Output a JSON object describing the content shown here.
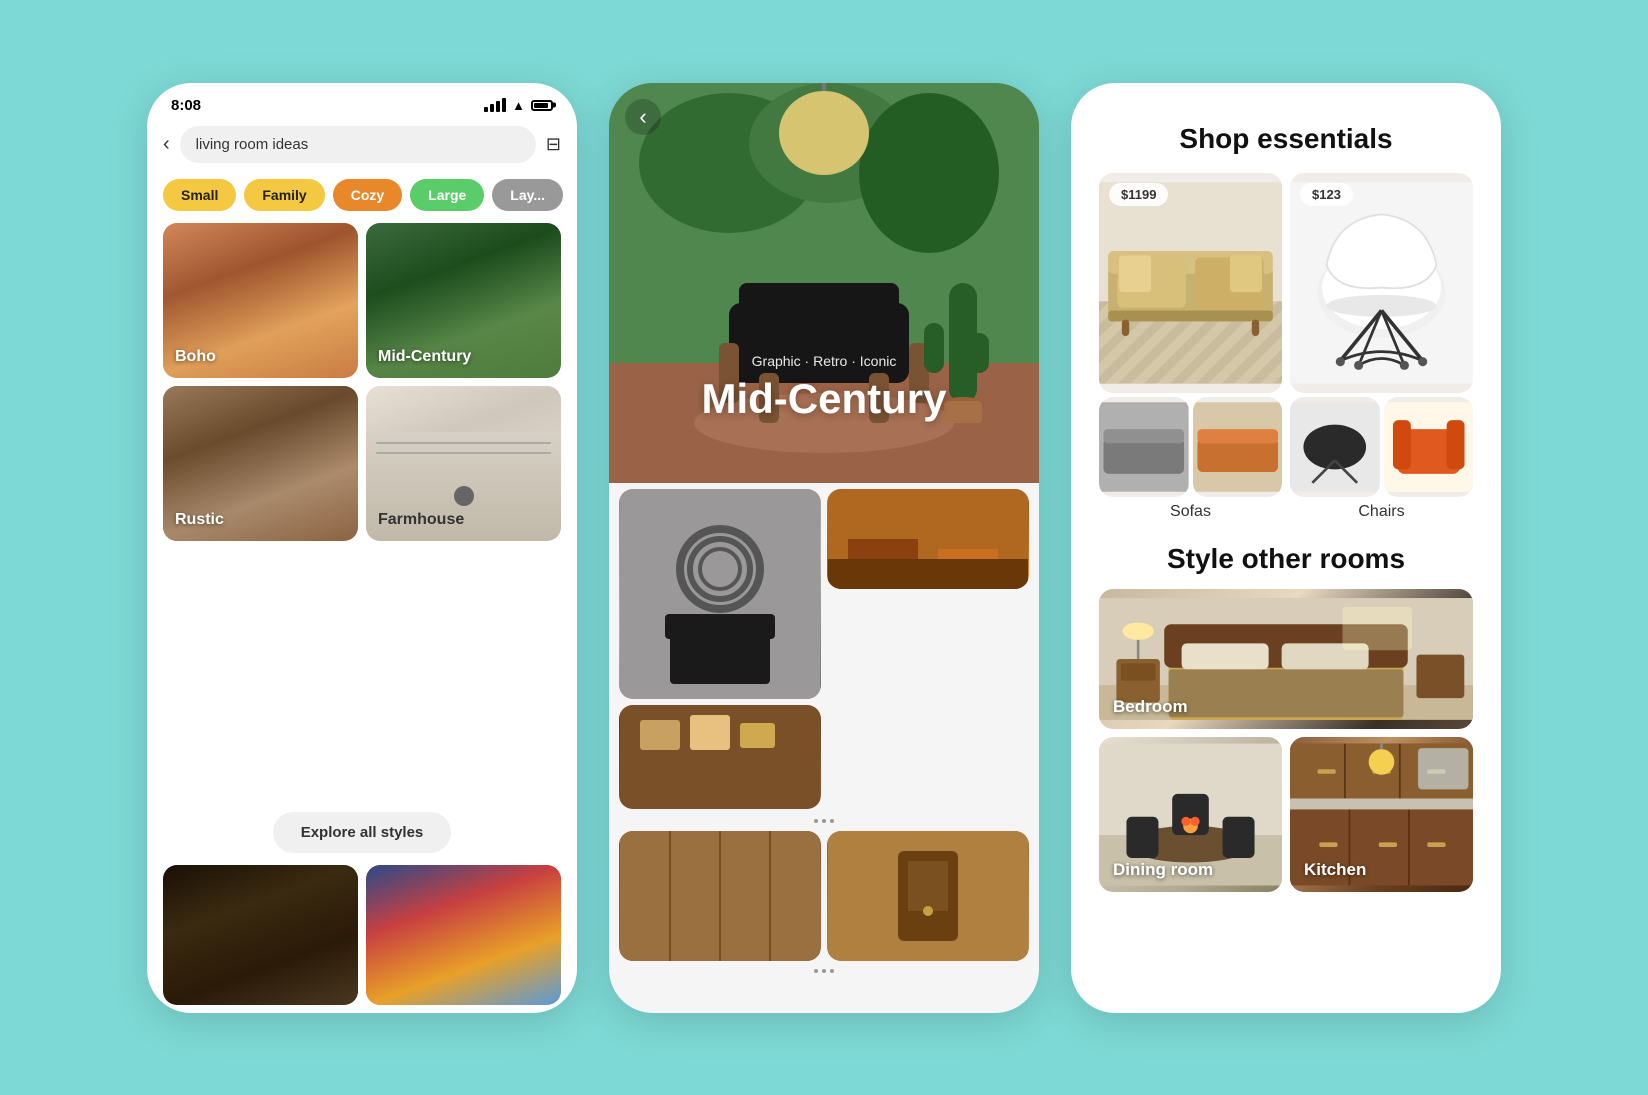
{
  "page": {
    "background_color": "#7dd9d5"
  },
  "phone1": {
    "status": {
      "time": "8:08"
    },
    "search": {
      "placeholder": "living room ideas",
      "value": "living room ideas"
    },
    "chips": [
      {
        "label": "Small",
        "color": "#f5c842",
        "text_color": "#222"
      },
      {
        "label": "Family",
        "color": "#f5c842",
        "text_color": "#222"
      },
      {
        "label": "Cozy",
        "color": "#e8882a",
        "text_color": "#fff"
      },
      {
        "label": "Large",
        "color": "#5acd6a",
        "text_color": "#fff"
      },
      {
        "label": "Lay...",
        "color": "#999",
        "text_color": "#fff"
      }
    ],
    "style_cards": [
      {
        "label": "Boho"
      },
      {
        "label": "Mid-Century"
      },
      {
        "label": "Rustic"
      },
      {
        "label": "Farmhouse"
      }
    ],
    "explore_button": "Explore all styles"
  },
  "phone2": {
    "back_label": "‹",
    "hero": {
      "subtitle": "Graphic · Retro · Iconic",
      "title": "Mid-Century"
    },
    "dots": 3
  },
  "panel3": {
    "shop_title": "Shop essentials",
    "products": [
      {
        "label": "Sofas",
        "price": "$1199"
      },
      {
        "label": "Chairs",
        "price": "$123"
      }
    ],
    "style_rooms_title": "Style other rooms",
    "rooms": [
      {
        "label": "Bedroom"
      },
      {
        "label": "Dining room"
      },
      {
        "label": "Kitchen"
      }
    ]
  }
}
